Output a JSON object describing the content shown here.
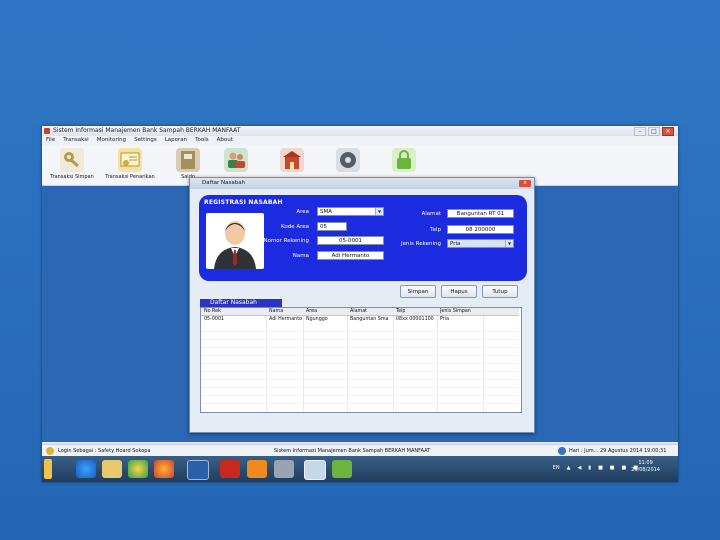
{
  "window": {
    "title": "Sistem Informasi Manajemen Bank Sampah BERKAH MANFAAT",
    "controls": [
      "–",
      "□",
      "✕"
    ]
  },
  "menu": [
    "File",
    "Transaksi",
    "Monitoring",
    "Settings",
    "Laporan",
    "Tools",
    "About"
  ],
  "toolbar": [
    {
      "label": "Transaksi Simpan",
      "icon": "key-icon",
      "color": "#8a7b55"
    },
    {
      "label": "Transaksi Penarikan",
      "icon": "certificate-icon",
      "color": "#c8a35a"
    },
    {
      "label": "Saldo",
      "icon": "book-icon",
      "color": "#8b7a5a"
    },
    {
      "label": "",
      "icon": "users-icon",
      "color": "#3f7f4a"
    },
    {
      "label": "",
      "icon": "building-icon",
      "color": "#c8452e"
    },
    {
      "label": "",
      "icon": "gear-icon",
      "color": "#555d66"
    },
    {
      "label": "",
      "icon": "lock-icon",
      "color": "#6cb33f"
    }
  ],
  "dialog": {
    "title": "Daftar Nasabah",
    "close": "x",
    "panel_title": "REGISTRASI NASABAH",
    "fields": {
      "area_label": "Area",
      "area_value": "SMA",
      "kode_area_label": "Kode Area",
      "kode_area_value": "05",
      "no_rek_label": "Nomor Rekening",
      "no_rek_value": "05-0001",
      "nama_label": "Nama",
      "nama_value": "Adi Hermanto",
      "alamat_label": "Alamat",
      "alamat_value": "Banguntan RT 01",
      "telp_label": "Telp",
      "telp_value": "08 200000",
      "jenis_label": "Jenis Rekening",
      "jenis_value": "Pria"
    },
    "buttons": {
      "simpan": "Simpan",
      "hapus": "Hapus",
      "tutup": "Tutup"
    },
    "list_title": "Daftar Nasabah",
    "columns": [
      "No Rek",
      "Nama",
      "Area",
      "Alamat",
      "Telp",
      "Jenis Simpan"
    ],
    "rows": [
      [
        "05-0001",
        "Adi Hermanto",
        "Ngunggo",
        "Banguntan Sma",
        "08xx 00001100",
        "Pria"
      ]
    ]
  },
  "status": {
    "login": "Login Sebagai : Safety Hoard Sokopa",
    "center": "Sistem Informasi Manajemen Bank Sampah BERKAH MANFAAT",
    "date": "Hari : Jum... 29 Agustus 2014  19:00:31"
  },
  "taskbar": {
    "lang": "EN",
    "time": "11:09",
    "date": "29/08/2014"
  },
  "colors": {
    "slide_blue": "#2a6fbd",
    "panel_blue": "#1d2be0",
    "desktop_blue": "#2b67b4"
  }
}
